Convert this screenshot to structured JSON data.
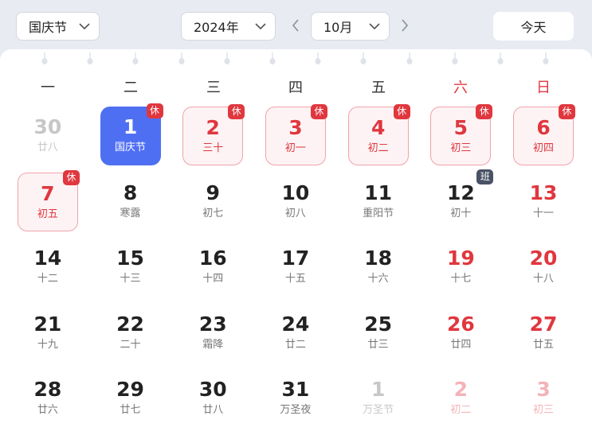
{
  "toolbar": {
    "holiday_select": "国庆节",
    "year_select": "2024年",
    "month_select": "10月",
    "today_label": "今天"
  },
  "weekdays": [
    "一",
    "二",
    "三",
    "四",
    "五",
    "六",
    "日"
  ],
  "badges": {
    "rest": "休",
    "work": "班"
  },
  "days": [
    {
      "num": "30",
      "sub": "廿八",
      "state": "other"
    },
    {
      "num": "1",
      "sub": "国庆节",
      "state": "selected",
      "badge": "rest"
    },
    {
      "num": "2",
      "sub": "三十",
      "state": "holiday",
      "badge": "rest"
    },
    {
      "num": "3",
      "sub": "初一",
      "state": "holiday",
      "badge": "rest"
    },
    {
      "num": "4",
      "sub": "初二",
      "state": "holiday",
      "badge": "rest"
    },
    {
      "num": "5",
      "sub": "初三",
      "state": "holiday",
      "badge": "rest"
    },
    {
      "num": "6",
      "sub": "初四",
      "state": "holiday",
      "badge": "rest"
    },
    {
      "num": "7",
      "sub": "初五",
      "state": "holiday",
      "badge": "rest"
    },
    {
      "num": "8",
      "sub": "寒露",
      "state": "normal"
    },
    {
      "num": "9",
      "sub": "初七",
      "state": "normal"
    },
    {
      "num": "10",
      "sub": "初八",
      "state": "normal"
    },
    {
      "num": "11",
      "sub": "重阳节",
      "state": "normal"
    },
    {
      "num": "12",
      "sub": "初十",
      "state": "normal",
      "badge": "work"
    },
    {
      "num": "13",
      "sub": "十一",
      "state": "weekend"
    },
    {
      "num": "14",
      "sub": "十二",
      "state": "normal"
    },
    {
      "num": "15",
      "sub": "十三",
      "state": "normal"
    },
    {
      "num": "16",
      "sub": "十四",
      "state": "normal"
    },
    {
      "num": "17",
      "sub": "十五",
      "state": "normal"
    },
    {
      "num": "18",
      "sub": "十六",
      "state": "normal"
    },
    {
      "num": "19",
      "sub": "十七",
      "state": "weekend"
    },
    {
      "num": "20",
      "sub": "十八",
      "state": "weekend"
    },
    {
      "num": "21",
      "sub": "十九",
      "state": "normal"
    },
    {
      "num": "22",
      "sub": "二十",
      "state": "normal"
    },
    {
      "num": "23",
      "sub": "霜降",
      "state": "normal"
    },
    {
      "num": "24",
      "sub": "廿二",
      "state": "normal"
    },
    {
      "num": "25",
      "sub": "廿三",
      "state": "normal"
    },
    {
      "num": "26",
      "sub": "廿四",
      "state": "weekend"
    },
    {
      "num": "27",
      "sub": "廿五",
      "state": "weekend"
    },
    {
      "num": "28",
      "sub": "廿六",
      "state": "normal"
    },
    {
      "num": "29",
      "sub": "廿七",
      "state": "normal"
    },
    {
      "num": "30",
      "sub": "廿八",
      "state": "normal"
    },
    {
      "num": "31",
      "sub": "万圣夜",
      "state": "normal"
    },
    {
      "num": "1",
      "sub": "万圣节",
      "state": "other"
    },
    {
      "num": "2",
      "sub": "初二",
      "state": "other-weekend"
    },
    {
      "num": "3",
      "sub": "初三",
      "state": "other-weekend"
    }
  ],
  "colors": {
    "accent": "#4f6ff3",
    "holiday_red": "#e0373f",
    "work_badge": "#4a5266",
    "background": "#e8ebf2"
  }
}
